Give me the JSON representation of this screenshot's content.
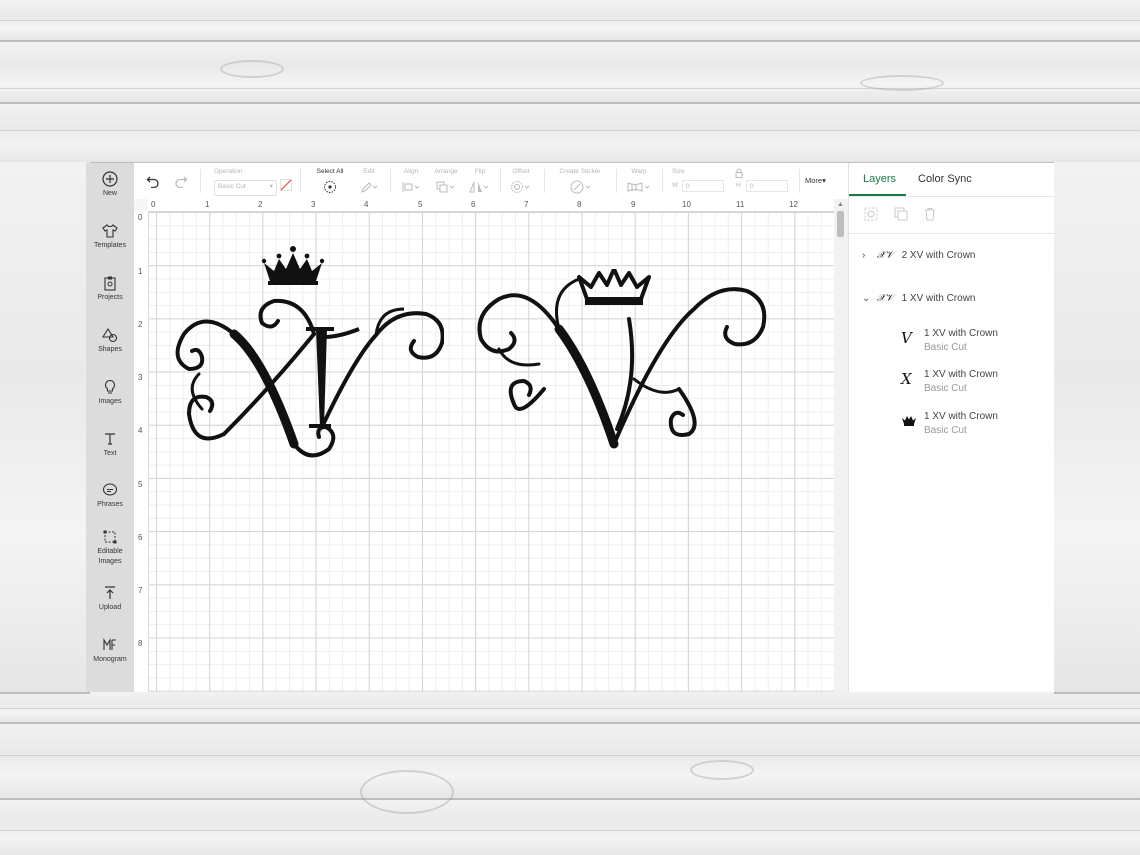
{
  "sidebar": {
    "items": [
      {
        "label": "New",
        "icon": "plus-circle-icon"
      },
      {
        "label": "Templates",
        "icon": "shirt-icon"
      },
      {
        "label": "Projects",
        "icon": "clipboard-icon"
      },
      {
        "label": "Shapes",
        "icon": "shapes-icon"
      },
      {
        "label": "Images",
        "icon": "lightbulb-icon"
      },
      {
        "label": "Text",
        "icon": "text-t-icon"
      },
      {
        "label": "Phrases",
        "icon": "speech-bubble-icon"
      },
      {
        "label": "Editable",
        "label2": "Images",
        "icon": "editable-image-icon"
      },
      {
        "label": "Upload",
        "icon": "upload-icon"
      },
      {
        "label": "Monogram",
        "icon": "monogram-icon"
      }
    ]
  },
  "toolbar": {
    "operation_label": "Operation",
    "operation_value": "Basic Cut",
    "select_all_label": "Select All",
    "edit_label": "Edit",
    "align_label": "Align",
    "arrange_label": "Arrange",
    "flip_label": "Flip",
    "offset_label": "Offset",
    "create_sticker_label": "Create Sticker",
    "warp_label": "Warp",
    "size_label": "Size",
    "width_prefix": "W",
    "width_value": "0",
    "height_prefix": "H",
    "height_value": "0",
    "more_label": "More"
  },
  "ruler": {
    "top": [
      "0",
      "1",
      "2",
      "3",
      "4",
      "5",
      "6",
      "7",
      "8",
      "9",
      "10",
      "11",
      "12"
    ],
    "left": [
      "0",
      "1",
      "2",
      "3",
      "4",
      "5",
      "6",
      "7",
      "8"
    ]
  },
  "canvas": {
    "design_left_letters": "XV",
    "design_right_letters": "XV"
  },
  "panel": {
    "tabs": [
      {
        "label": "Layers",
        "active": true
      },
      {
        "label": "Color Sync",
        "active": false
      }
    ],
    "groups": [
      {
        "name": "2 XV with Crown",
        "expanded": false
      },
      {
        "name": "1 XV with Crown",
        "expanded": true,
        "children": [
          {
            "name": "1 XV with Crown",
            "operation": "Basic Cut",
            "thumb": "V"
          },
          {
            "name": "1 XV with Crown",
            "operation": "Basic Cut",
            "thumb": "X"
          },
          {
            "name": "1 XV with Crown",
            "operation": "Basic Cut",
            "thumb": "crown"
          }
        ]
      }
    ]
  },
  "colors": {
    "accent": "#1a7a45",
    "sidebar_bg": "#dcdcdc",
    "design_ink": "#111111"
  }
}
